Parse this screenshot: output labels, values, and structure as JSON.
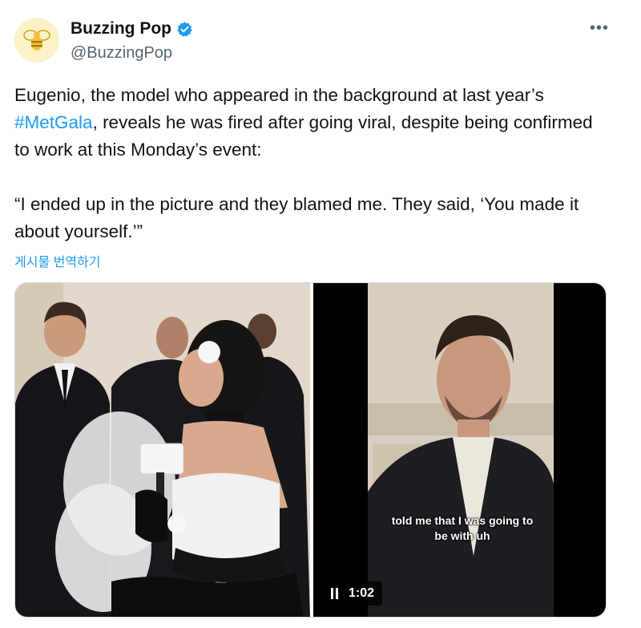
{
  "author": {
    "display_name": "Buzzing Pop",
    "handle": "@BuzzingPop",
    "avatar_icon": "bee-icon",
    "verified_icon": "verified-badge-icon",
    "verified_color": "#1d9bf0"
  },
  "more_icon": "more-options-icon",
  "more_label": "•••",
  "tweet": {
    "line1_pre": "Eugenio, the model who appeared in the background at last year’s ",
    "hashtag": "#MetGala",
    "line1_post": ", reveals he was fired after going viral, despite being confirmed to work at this Monday’s event:",
    "quote": "“I ended up in the picture and they blamed me. They said, ‘You made it about yourself.’”"
  },
  "translate_label": "게시물 번역하기",
  "media": {
    "photo_alt": "Red carpet interview photo",
    "video": {
      "caption_line1": "told me that I was going to",
      "caption_line2": "be with uh",
      "time": "1:02",
      "pause_icon": "pause-icon"
    }
  },
  "colors": {
    "accent": "#1d9bf0",
    "text": "#0f1419",
    "secondary": "#536471"
  }
}
